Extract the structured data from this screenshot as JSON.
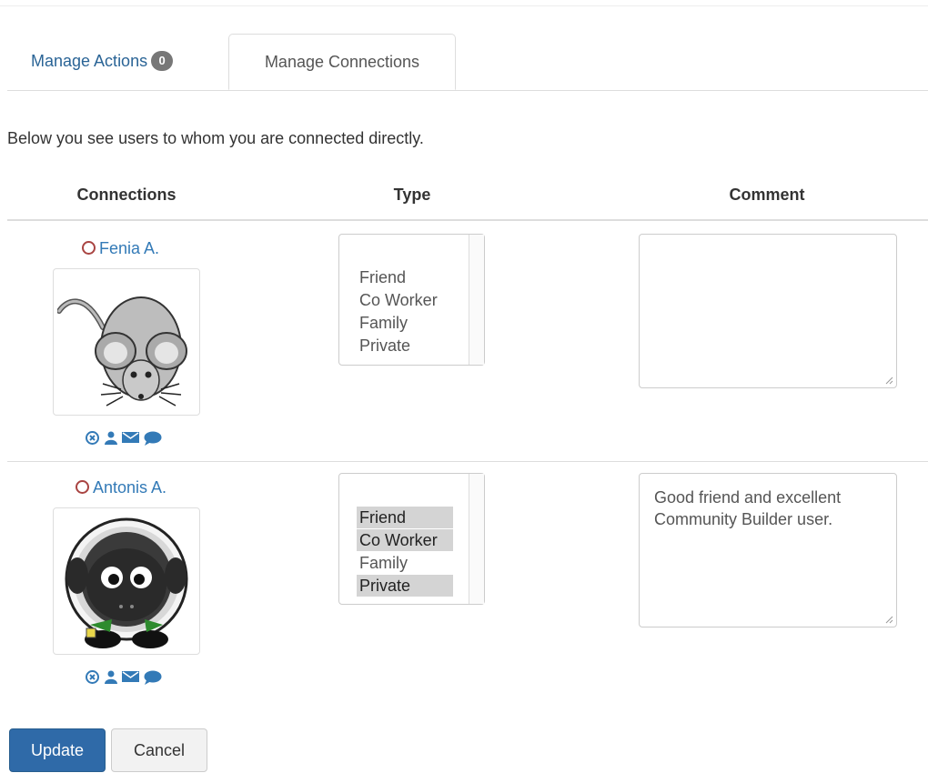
{
  "tabs": {
    "manage_actions": "Manage Actions",
    "actions_count": "0",
    "manage_connections": "Manage Connections"
  },
  "intro_text": "Below you see users to whom you are connected directly.",
  "columns": {
    "connections": "Connections",
    "type": "Type",
    "comment": "Comment"
  },
  "type_options": [
    "Friend",
    "Co Worker",
    "Family",
    "Private"
  ],
  "connections": [
    {
      "name": "Fenia A.",
      "avatar": "mouse",
      "selected_types": [],
      "comment": ""
    },
    {
      "name": "Antonis A.",
      "avatar": "sheep",
      "selected_types": [
        "Friend",
        "Co Worker",
        "Private"
      ],
      "comment": "Good friend and excellent Community Builder user."
    }
  ],
  "action_icons": [
    "remove-icon",
    "user-icon",
    "envelope-icon",
    "chat-icon"
  ],
  "buttons": {
    "update": "Update",
    "cancel": "Cancel"
  },
  "colors": {
    "link": "#337ab7",
    "primary": "#2f6aa8",
    "offline_status": "#a94442",
    "selected_option": "#d4d4d4"
  }
}
